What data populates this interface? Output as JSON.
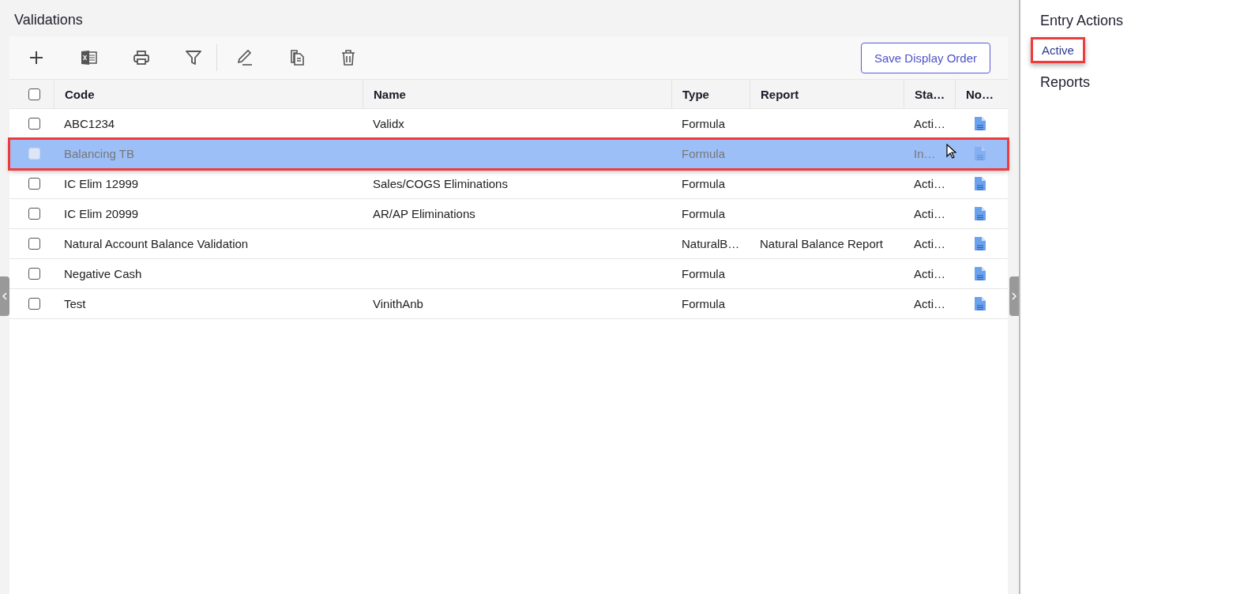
{
  "page_title": "Validations",
  "toolbar": {
    "tools": [
      {
        "kind": "add"
      },
      {
        "kind": "excel"
      },
      {
        "kind": "print"
      },
      {
        "kind": "filter"
      },
      {
        "kind": "divider"
      },
      {
        "kind": "edit"
      },
      {
        "kind": "copy"
      },
      {
        "kind": "delete"
      }
    ],
    "save_button": "Save Display Order"
  },
  "table": {
    "header_checkbox": {
      "checked": false
    },
    "columns": [
      "Code",
      "Name",
      "Type",
      "Report",
      "Sta…",
      "No…"
    ],
    "rows": [
      {
        "code": "ABC1234",
        "name": "Validx",
        "type": "Formula",
        "report": "",
        "status": "Acti…",
        "checked": false,
        "selected": false,
        "highlighted": false
      },
      {
        "code": "Balancing TB",
        "name": "",
        "type": "Formula",
        "report": "",
        "status": "In…",
        "checked": false,
        "selected": true,
        "highlighted": true
      },
      {
        "code": "IC Elim 12999",
        "name": "Sales/COGS Eliminations",
        "type": "Formula",
        "report": "",
        "status": "Acti…",
        "checked": false,
        "selected": false,
        "highlighted": false
      },
      {
        "code": "IC Elim 20999",
        "name": "AR/AP Eliminations",
        "type": "Formula",
        "report": "",
        "status": "Acti…",
        "checked": false,
        "selected": false,
        "highlighted": false
      },
      {
        "code": "Natural Account Balance Validation",
        "name": "",
        "type": "NaturalB…",
        "report": "Natural Balance Report",
        "status": "Acti…",
        "checked": false,
        "selected": false,
        "highlighted": false
      },
      {
        "code": "Negative Cash",
        "name": "",
        "type": "Formula",
        "report": "",
        "status": "Acti…",
        "checked": false,
        "selected": false,
        "highlighted": false
      },
      {
        "code": "Test",
        "name": "VinithAnb",
        "type": "Formula",
        "report": "",
        "status": "Acti…",
        "checked": false,
        "selected": false,
        "highlighted": false
      }
    ]
  },
  "side_panel": {
    "title": "Entry Actions",
    "items": [
      {
        "label": "Active",
        "highlighted": true
      }
    ],
    "reports_heading": "Reports"
  }
}
